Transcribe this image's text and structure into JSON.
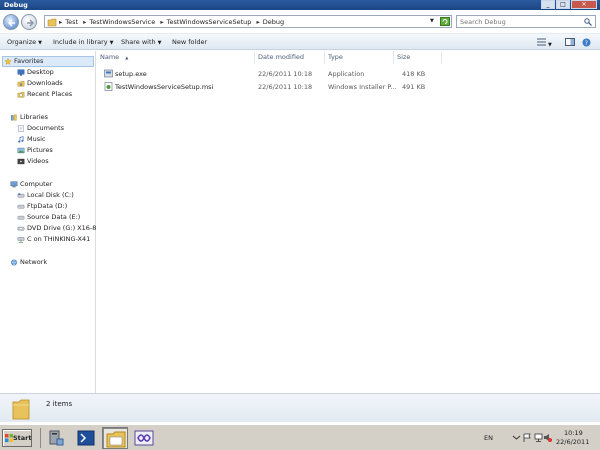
{
  "window": {
    "title": "Debug",
    "controls": [
      "_",
      "□",
      "✕"
    ]
  },
  "address": {
    "crumbs": [
      "Test",
      "TestWindowsService",
      "TestWindowsServiceSetup",
      "Debug"
    ],
    "search_placeholder": "Search Debug"
  },
  "toolbar": {
    "organize": "Organize",
    "include": "Include in library",
    "share": "Share with",
    "newfolder": "New folder"
  },
  "nav": {
    "favorites": {
      "label": "Favorites",
      "items": [
        "Desktop",
        "Downloads",
        "Recent Places"
      ]
    },
    "libraries": {
      "label": "Libraries",
      "items": [
        "Documents",
        "Music",
        "Pictures",
        "Videos"
      ]
    },
    "computer": {
      "label": "Computer",
      "items": [
        "Local Disk (C:)",
        "FtpData (D:)",
        "Source Data (E:)",
        "DVD Drive (G:) X16-8",
        "C on THINKING-X41"
      ]
    },
    "network": {
      "label": "Network"
    }
  },
  "columns": {
    "name": "Name",
    "date": "Date modified",
    "type": "Type",
    "size": "Size"
  },
  "files": [
    {
      "name": "setup.exe",
      "date": "22/6/2011 10:18",
      "type": "Application",
      "size": "418 KB",
      "icon": "installer-icon"
    },
    {
      "name": "TestWindowsServiceSetup.msi",
      "date": "22/6/2011 10:18",
      "type": "Windows Installer P...",
      "size": "491 KB",
      "icon": "msi-icon"
    }
  ],
  "details": {
    "count": "2 items"
  },
  "taskbar": {
    "start": "Start",
    "lang": "EN",
    "time": "10:19",
    "date": "22/6/2011"
  },
  "colors": {
    "titlebar": "#1c4684",
    "selection": "#dbe9f8",
    "taskbar": "#d4d0c8"
  }
}
